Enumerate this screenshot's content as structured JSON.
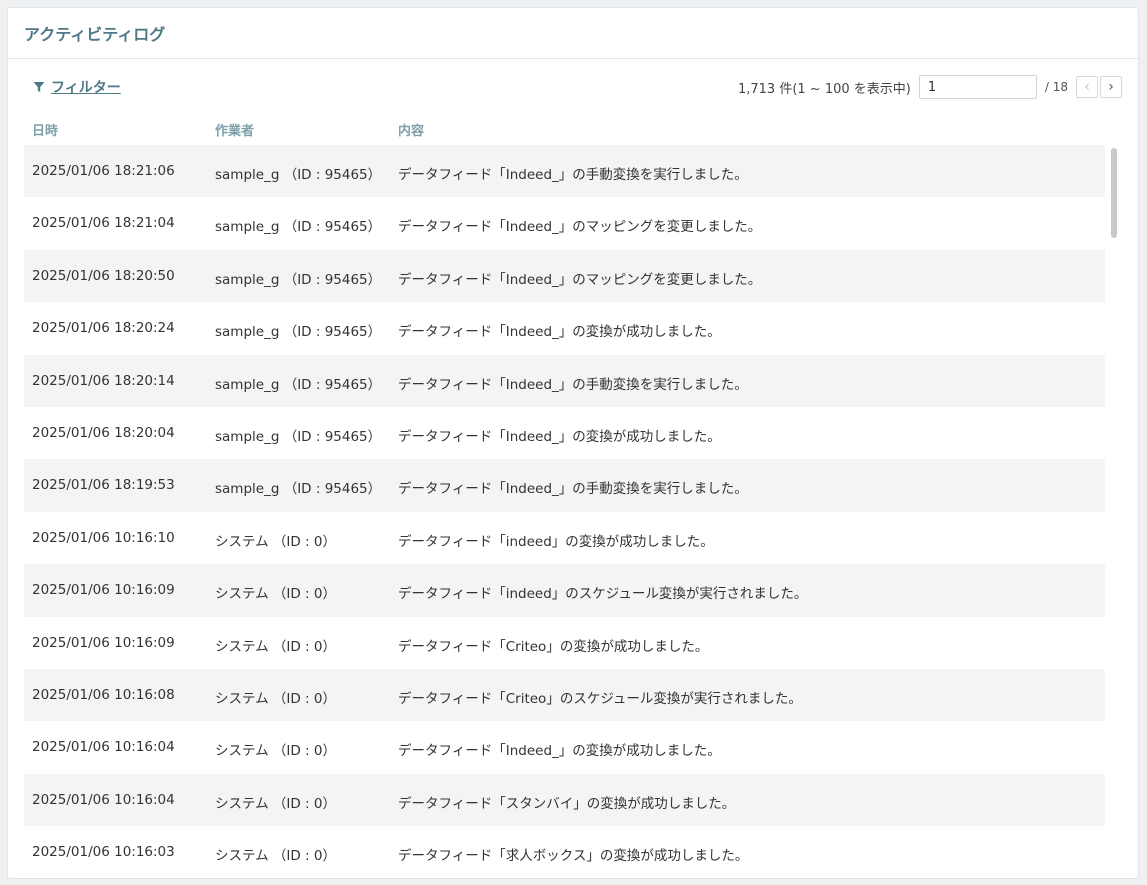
{
  "panel": {
    "title": "アクティビティログ"
  },
  "toolbar": {
    "filter_label": "フィルター",
    "count_text": "1,713 件(1 ~ 100 を表示中)",
    "page_value": "1",
    "page_total": "/ 18",
    "prev_symbol": "‹",
    "next_symbol": "›"
  },
  "columns": {
    "date": "日時",
    "user": "作業者",
    "content": "内容"
  },
  "rows": [
    {
      "date": "2025/01/06 18:21:06",
      "user": "sample_g （ID : 95465）",
      "content": "データフィード「Indeed_」の手動変換を実行しました。"
    },
    {
      "date": "2025/01/06 18:21:04",
      "user": "sample_g （ID : 95465）",
      "content": "データフィード「Indeed_」のマッピングを変更しました。"
    },
    {
      "date": "2025/01/06 18:20:50",
      "user": "sample_g （ID : 95465）",
      "content": "データフィード「Indeed_」のマッピングを変更しました。"
    },
    {
      "date": "2025/01/06 18:20:24",
      "user": "sample_g （ID : 95465）",
      "content": "データフィード「Indeed_」の変換が成功しました。"
    },
    {
      "date": "2025/01/06 18:20:14",
      "user": "sample_g （ID : 95465）",
      "content": "データフィード「Indeed_」の手動変換を実行しました。"
    },
    {
      "date": "2025/01/06 18:20:04",
      "user": "sample_g （ID : 95465）",
      "content": "データフィード「Indeed_」の変換が成功しました。"
    },
    {
      "date": "2025/01/06 18:19:53",
      "user": "sample_g （ID : 95465）",
      "content": "データフィード「Indeed_」の手動変換を実行しました。"
    },
    {
      "date": "2025/01/06 10:16:10",
      "user": "システム （ID : 0）",
      "content": "データフィード「indeed」の変換が成功しました。"
    },
    {
      "date": "2025/01/06 10:16:09",
      "user": "システム （ID : 0）",
      "content": "データフィード「indeed」のスケジュール変換が実行されました。"
    },
    {
      "date": "2025/01/06 10:16:09",
      "user": "システム （ID : 0）",
      "content": "データフィード「Criteo」の変換が成功しました。"
    },
    {
      "date": "2025/01/06 10:16:08",
      "user": "システム （ID : 0）",
      "content": "データフィード「Criteo」のスケジュール変換が実行されました。"
    },
    {
      "date": "2025/01/06 10:16:04",
      "user": "システム （ID : 0）",
      "content": "データフィード「Indeed_」の変換が成功しました。"
    },
    {
      "date": "2025/01/06 10:16:04",
      "user": "システム （ID : 0）",
      "content": "データフィード「スタンバイ」の変換が成功しました。"
    },
    {
      "date": "2025/01/06 10:16:03",
      "user": "システム （ID : 0）",
      "content": "データフィード「求人ボックス」の変換が成功しました。"
    }
  ]
}
